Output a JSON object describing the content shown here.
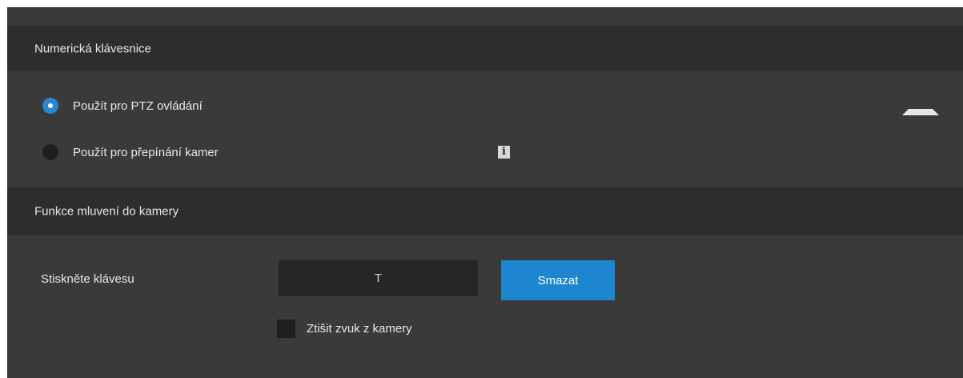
{
  "numpad_section": {
    "title": "Numerická klávesnice",
    "options": [
      {
        "label": "Použít pro PTZ ovládání",
        "selected": true
      },
      {
        "label": "Použít pro přepínání kamer",
        "selected": false
      }
    ],
    "info_icon": "info-icon",
    "collapse_icon": "collapse-icon"
  },
  "talk_section": {
    "title": "Funkce mluvení do kamery",
    "key_label": "Stiskněte klávesu",
    "key_value": "T",
    "clear_button": "Smazat",
    "mute_label": "Ztišit zvuk z kamery",
    "mute_checked": false
  },
  "colors": {
    "accent": "#1e86cf",
    "panel_bg": "#3a3a3a",
    "header_bg": "#2d2d2d"
  }
}
